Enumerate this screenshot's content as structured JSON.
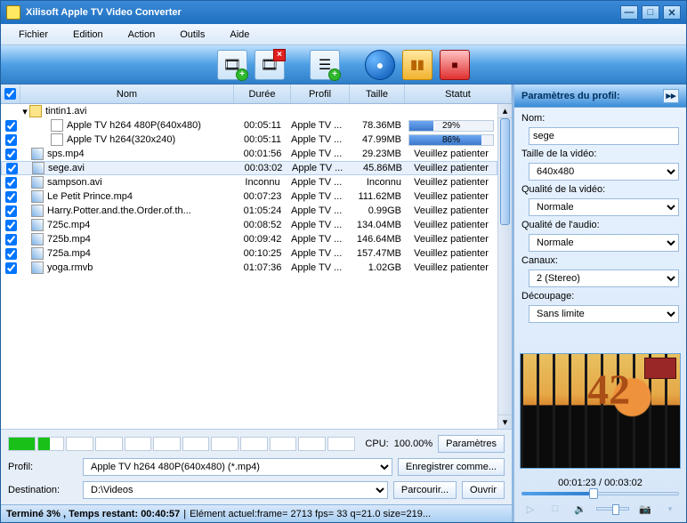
{
  "window": {
    "title": "Xilisoft Apple TV Video Converter"
  },
  "menu": {
    "file": "Fichier",
    "edit": "Edition",
    "action": "Action",
    "tools": "Outils",
    "help": "Aide"
  },
  "columns": {
    "name": "Nom",
    "duration": "Durée",
    "profile": "Profil",
    "size": "Taille",
    "status": "Statut"
  },
  "folder": {
    "name": "tintin1.avi"
  },
  "files": [
    {
      "name": "Apple TV h264 480P(640x480)",
      "dur": "00:05:11",
      "prof": "Apple TV ...",
      "size": "78.36MB",
      "pct": 29,
      "status": null,
      "indent": 2,
      "icon": "page"
    },
    {
      "name": "Apple TV h264(320x240)",
      "dur": "00:05:11",
      "prof": "Apple TV ...",
      "size": "47.99MB",
      "pct": 86,
      "status": null,
      "indent": 2,
      "icon": "page"
    },
    {
      "name": "sps.mp4",
      "dur": "00:01:56",
      "prof": "Apple TV ...",
      "size": "29.23MB",
      "pct": null,
      "status": "Veuillez patienter",
      "indent": 1,
      "icon": "video"
    },
    {
      "name": "sege.avi",
      "dur": "00:03:02",
      "prof": "Apple TV ...",
      "size": "45.86MB",
      "pct": null,
      "status": "Veuillez patienter",
      "indent": 1,
      "icon": "video",
      "selected": true
    },
    {
      "name": "sampson.avi",
      "dur": "Inconnu",
      "prof": "Apple TV ...",
      "size": "Inconnu",
      "pct": null,
      "status": "Veuillez patienter",
      "indent": 1,
      "icon": "video"
    },
    {
      "name": "Le Petit Prince.mp4",
      "dur": "00:07:23",
      "prof": "Apple TV ...",
      "size": "111.62MB",
      "pct": null,
      "status": "Veuillez patienter",
      "indent": 1,
      "icon": "video"
    },
    {
      "name": "Harry.Potter.and.the.Order.of.th...",
      "dur": "01:05:24",
      "prof": "Apple TV ...",
      "size": "0.99GB",
      "pct": null,
      "status": "Veuillez patienter",
      "indent": 1,
      "icon": "video"
    },
    {
      "name": "725c.mp4",
      "dur": "00:08:52",
      "prof": "Apple TV ...",
      "size": "134.04MB",
      "pct": null,
      "status": "Veuillez patienter",
      "indent": 1,
      "icon": "video"
    },
    {
      "name": "725b.mp4",
      "dur": "00:09:42",
      "prof": "Apple TV ...",
      "size": "146.64MB",
      "pct": null,
      "status": "Veuillez patienter",
      "indent": 1,
      "icon": "video"
    },
    {
      "name": "725a.mp4",
      "dur": "00:10:25",
      "prof": "Apple TV ...",
      "size": "157.47MB",
      "pct": null,
      "status": "Veuillez patienter",
      "indent": 1,
      "icon": "video"
    },
    {
      "name": "yoga.rmvb",
      "dur": "01:07:36",
      "prof": "Apple TV ...",
      "size": "1.02GB",
      "pct": null,
      "status": "Veuillez patienter",
      "indent": 1,
      "icon": "video"
    }
  ],
  "cpu": {
    "label": "CPU:",
    "value": "100.00%"
  },
  "params_btn": "Paramètres",
  "profile": {
    "label": "Profil:",
    "value": "Apple TV h264 480P(640x480) (*.mp4)"
  },
  "save_as": "Enregistrer comme...",
  "destination": {
    "label": "Destination:",
    "value": "D:\\Videos"
  },
  "browse": "Parcourir...",
  "open": "Ouvrir",
  "status": {
    "done": "Terminé 3% , Temps restant: 00:40:57",
    "current": "Elément actuel:frame= 2713 fps= 33 q=21.0 size=219..."
  },
  "panel": {
    "title": "Paramètres du profil:",
    "name_label": "Nom:",
    "name_value": "sege",
    "vsize_label": "Taille de la vidéo:",
    "vsize_value": "640x480",
    "vqual_label": "Qualité de la vidéo:",
    "vqual_value": "Normale",
    "aqual_label": "Qualité de l'audio:",
    "aqual_value": "Normale",
    "channels_label": "Canaux:",
    "channels_value": "2 (Stereo)",
    "trim_label": "Découpage:",
    "trim_value": "Sans limite"
  },
  "player": {
    "time": "00:01:23 / 00:03:02",
    "seek_pct": 46,
    "vol_pct": 60
  }
}
